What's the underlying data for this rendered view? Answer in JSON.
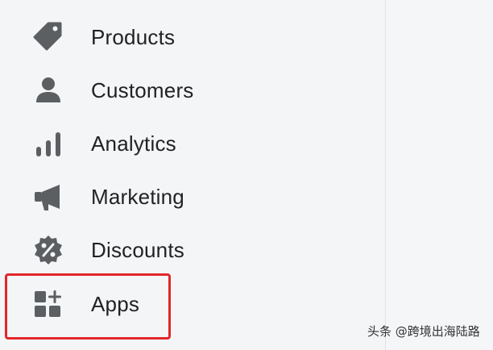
{
  "sidebar": {
    "items": [
      {
        "label": "Products",
        "icon": "tag-icon"
      },
      {
        "label": "Customers",
        "icon": "person-icon"
      },
      {
        "label": "Analytics",
        "icon": "bar-chart-icon"
      },
      {
        "label": "Marketing",
        "icon": "megaphone-icon"
      },
      {
        "label": "Discounts",
        "icon": "discount-badge-icon"
      },
      {
        "label": "Apps",
        "icon": "apps-add-icon"
      }
    ],
    "highlighted_item": "Apps"
  },
  "colors": {
    "icon": "#5c5f62",
    "text": "#202223",
    "highlight": "#e3262b",
    "background": "#f3f5f7"
  },
  "watermark": {
    "text": "头条 @跨境出海陆路"
  }
}
